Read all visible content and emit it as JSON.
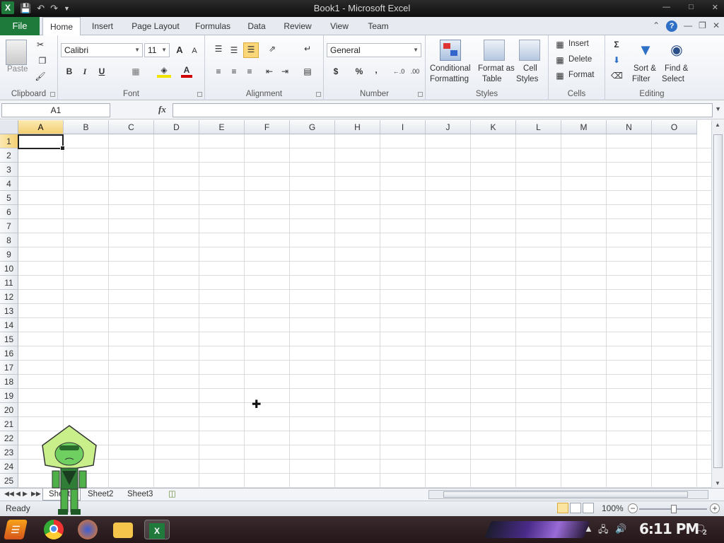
{
  "window": {
    "title": "Book1  -  Microsoft Excel",
    "app_icon": "excel-logo-icon",
    "qat": [
      "save-icon",
      "undo-icon",
      "redo-icon",
      "customize-icon"
    ]
  },
  "tabs": {
    "file": "File",
    "items": [
      "Home",
      "Insert",
      "Page Layout",
      "Formulas",
      "Data",
      "Review",
      "View",
      "Team"
    ],
    "active": "Home"
  },
  "ribbon": {
    "clipboard": {
      "label": "Clipboard",
      "paste": "Paste"
    },
    "font": {
      "label": "Font",
      "family": "Calibri",
      "size": "11",
      "bold": "B",
      "italic": "I",
      "underline": "U",
      "grow": "A",
      "shrink": "A"
    },
    "alignment": {
      "label": "Alignment"
    },
    "number": {
      "label": "Number",
      "format": "General",
      "currency": "$",
      "percent": "%",
      "comma": ",",
      "inc_dec": ".0​.00",
      "dec_dec": ".00"
    },
    "styles": {
      "label": "Styles",
      "conditional_1": "Conditional",
      "conditional_2": "Formatting",
      "format_table_1": "Format as",
      "format_table_2": "Table",
      "cell_styles_1": "Cell",
      "cell_styles_2": "Styles"
    },
    "cells": {
      "label": "Cells",
      "insert": "Insert",
      "delete": "Delete",
      "format": "Format"
    },
    "editing": {
      "label": "Editing",
      "sort_1": "Sort &",
      "sort_2": "Filter",
      "find_1": "Find &",
      "find_2": "Select",
      "sum": "Σ"
    }
  },
  "formula_bar": {
    "name_box": "A1",
    "fx": "fx",
    "value": ""
  },
  "grid": {
    "columns": [
      "A",
      "B",
      "C",
      "D",
      "E",
      "F",
      "G",
      "H",
      "I",
      "J",
      "K",
      "L",
      "M",
      "N",
      "O"
    ],
    "rows": [
      "1",
      "2",
      "3",
      "4",
      "5",
      "6",
      "7",
      "8",
      "9",
      "10",
      "11",
      "12",
      "13",
      "14",
      "15",
      "16",
      "17",
      "18",
      "19",
      "20",
      "21",
      "22",
      "23",
      "24",
      "25"
    ],
    "active_cell": "A1"
  },
  "sheets": {
    "tabs": [
      "Sheet1",
      "Sheet2",
      "Sheet3"
    ],
    "active": "Sheet1"
  },
  "status": {
    "text": "Ready",
    "zoom": "100%"
  },
  "taskbar": {
    "clock": "6:11 PM",
    "notifications": "2"
  },
  "colors": {
    "file_tab": "#1d7a3a",
    "active_header": "#f4cf72",
    "taskbar": "#2e1f23"
  }
}
